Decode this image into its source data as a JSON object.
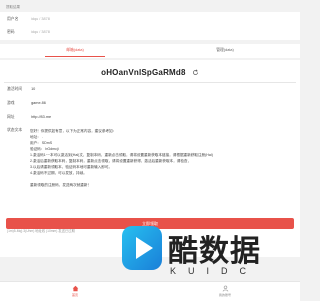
{
  "header": {
    "title": "提取结果"
  },
  "form": {
    "fields": [
      {
        "label": "用户名",
        "value": "idqu / 3878"
      },
      {
        "label": "密码",
        "value": "idqu / 3878"
      }
    ]
  },
  "tabs": [
    {
      "label": "邮箱(data)",
      "active": true
    },
    {
      "label": "管理(data)",
      "active": false
    }
  ],
  "result": {
    "code": "oHOanVnlSpGaRMd8",
    "rows": [
      {
        "label": "激活时间",
        "value": "10"
      },
      {
        "label": "游戏",
        "value": "game.86"
      },
      {
        "label": "网址",
        "value": "http://83.me"
      }
    ],
    "desc_label": "状态文本",
    "desc_lines": [
      "您好！你提供如有意，以下为正常内容，建议参考如：",
      "地址：  .",
      "用户：  SDmS",
      "验证码：  bGdmcji",
      "1.激活码1~~本可以激活到(Hal)文，复制本码，重新点击领取，请将设置重新获取本链接，请根据重新获取注册(Hal)",
      "2.激活后重新获取本码，复制本码，重新点击领取，请将设置重新获得，激活后重新获取本，请检查，",
      "3.以后请重新领取本，验证码本地可重新输入即可。",
      "4.激活码不过期，可以发放，持续。",
      "",
      "重新领取的注册码，发送两次就重新！"
    ],
    "sub_label": "状态文本显示",
    "sub_value": "(1m)5-Mq) 3(Uhm) 地址线 (10mm) 发送已过期"
  },
  "button": {
    "label": "立即领取"
  },
  "watermark": {
    "title": "酷数据",
    "subtitle": "KUIDC"
  },
  "nav": [
    {
      "label": "首页",
      "icon": "home-icon",
      "active": true
    },
    {
      "label": "我的账号",
      "icon": "user-icon",
      "active": false
    }
  ],
  "colors": {
    "accent": "#e8524a",
    "watermark": "#1aa8e8"
  }
}
